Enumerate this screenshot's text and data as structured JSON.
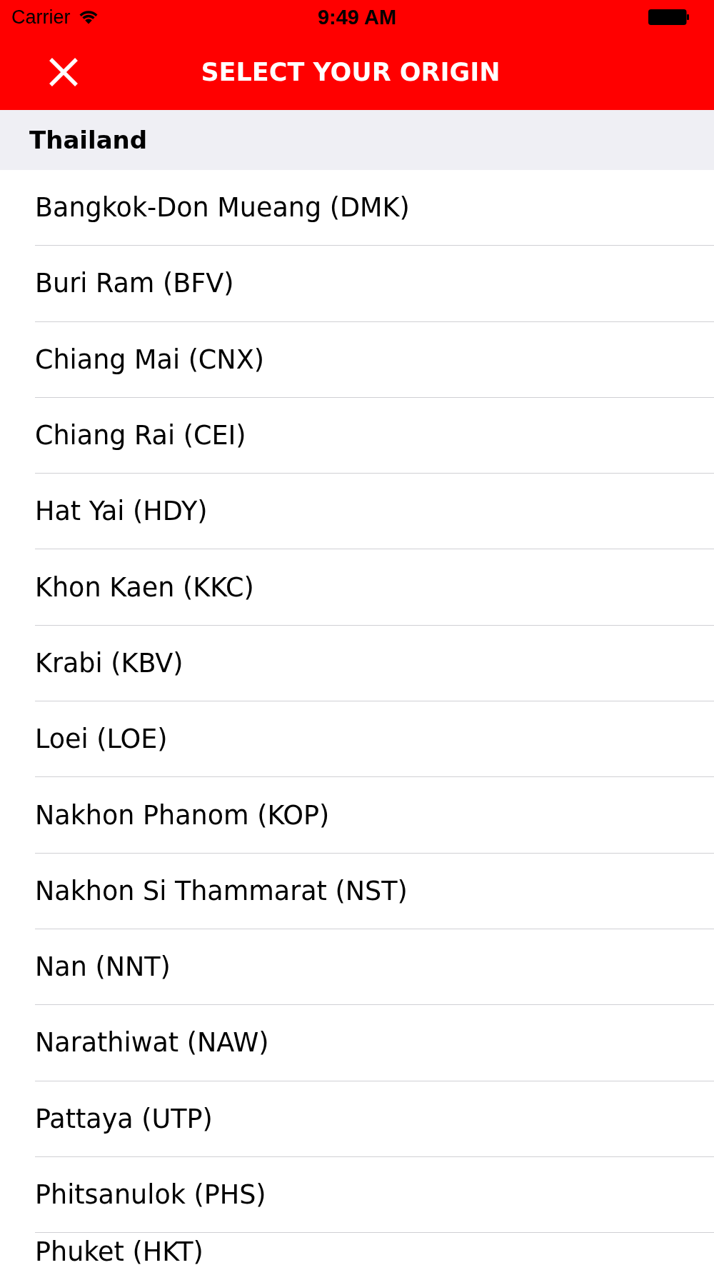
{
  "status_bar": {
    "carrier": "Carrier",
    "time": "9:49 AM"
  },
  "nav_bar": {
    "title": "SELECT YOUR ORIGIN"
  },
  "sections": [
    {
      "title": "Thailand",
      "items": [
        "Bangkok-Don Mueang (DMK)",
        "Buri Ram (BFV)",
        "Chiang Mai (CNX)",
        "Chiang Rai (CEI)",
        "Hat Yai (HDY)",
        "Khon Kaen (KKC)",
        "Krabi (KBV)",
        "Loei (LOE)",
        "Nakhon Phanom (KOP)",
        "Nakhon Si Thammarat (NST)",
        "Nan (NNT)",
        "Narathiwat (NAW)",
        "Pattaya (UTP)",
        "Phitsanulok (PHS)",
        "Phuket (HKT)"
      ]
    }
  ]
}
